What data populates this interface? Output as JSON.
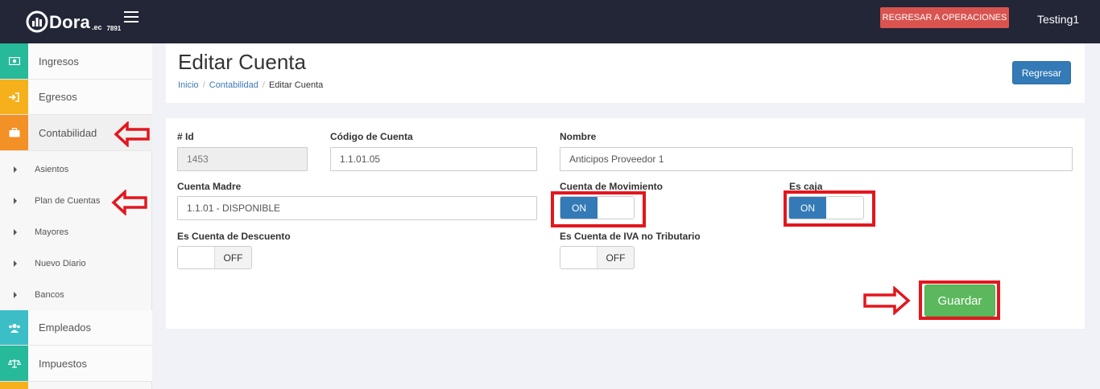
{
  "topbar": {
    "brand": "Dora",
    "brand_tld": ".ec",
    "brand_code": "7891",
    "ops_button": "REGRESAR A OPERACIONES",
    "username": "Testing1"
  },
  "sidebar": {
    "items": [
      {
        "label": "Ingresos",
        "icon": "money-icon",
        "color": "#26b99a"
      },
      {
        "label": "Egresos",
        "icon": "sign-in-icon",
        "color": "#f5b01c"
      },
      {
        "label": "Contabilidad",
        "icon": "briefcase-icon",
        "color": "#f39026"
      },
      {
        "label": "Empleados",
        "icon": "users-icon",
        "color": "#3cbec7"
      },
      {
        "label": "Impuestos",
        "icon": "balance-scale-icon",
        "color": "#26b99a"
      }
    ],
    "sub_items": [
      "Asientos",
      "Plan de Cuentas",
      "Mayores",
      "Nuevo Diario",
      "Bancos"
    ]
  },
  "header": {
    "title": "Editar Cuenta",
    "breadcrumb": [
      "Inicio",
      "Contabilidad",
      "Editar Cuenta"
    ],
    "back_button": "Regresar"
  },
  "form": {
    "id_label": "# Id",
    "id_value": "1453",
    "code_label": "Código de Cuenta",
    "code_value": "1.1.01.05",
    "name_label": "Nombre",
    "name_value": "Anticipos Proveedor 1",
    "parent_label": "Cuenta Madre",
    "parent_value": "1.1.01 - DISPONIBLE",
    "movement_label": "Cuenta de Movimiento",
    "movement_state": "ON",
    "cash_label": "Es caja",
    "cash_state": "ON",
    "discount_label": "Es Cuenta de Descuento",
    "discount_state": "OFF",
    "iva_label": "Es Cuenta de IVA no Tributario",
    "iva_state": "OFF",
    "save_button": "Guardar"
  },
  "colors": {
    "topbar": "#222636",
    "primary": "#337ab7",
    "danger": "#d9534f",
    "success": "#5cb85c",
    "annotation": "#e3161e"
  }
}
